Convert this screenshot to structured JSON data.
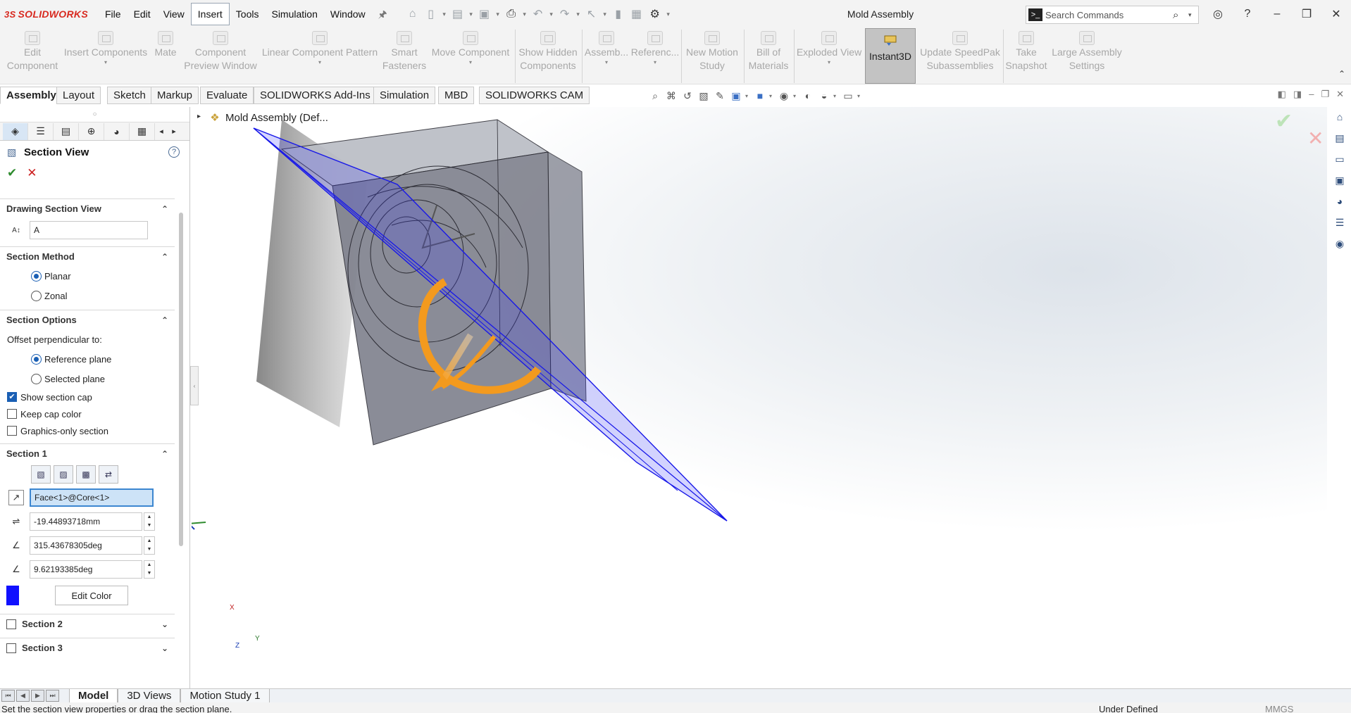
{
  "app": {
    "name": "SOLIDWORKS",
    "document_title": "Mold Assembly"
  },
  "menu": [
    "File",
    "Edit",
    "View",
    "Insert",
    "Tools",
    "Simulation",
    "Window"
  ],
  "menu_active": "Insert",
  "search": {
    "placeholder": "Search Commands"
  },
  "ribbon": {
    "edit_component": [
      "Edit",
      "Component"
    ],
    "insert_components": [
      "Insert Components"
    ],
    "mate": [
      "Mate"
    ],
    "component_preview": [
      "Component",
      "Preview Window"
    ],
    "linear_pattern": [
      "Linear Component Pattern"
    ],
    "smart_fasteners": [
      "Smart",
      "Fasteners"
    ],
    "move_component": [
      "Move Component"
    ],
    "show_hidden": [
      "Show Hidden",
      "Components"
    ],
    "assembly_features": [
      "Assemb..."
    ],
    "reference_geometry": [
      "Referenc..."
    ],
    "new_motion_study": [
      "New Motion",
      "Study"
    ],
    "bill_of_materials": [
      "Bill of",
      "Materials"
    ],
    "exploded_view": [
      "Exploded View"
    ],
    "instant3d": "Instant3D",
    "update_speedpak": [
      "Update SpeedPak",
      "Subassemblies"
    ],
    "take_snapshot": [
      "Take",
      "Snapshot"
    ],
    "large_assembly": [
      "Large Assembly",
      "Settings"
    ]
  },
  "command_tabs": [
    "Assembly",
    "Layout",
    "Sketch",
    "Markup",
    "Evaluate",
    "SOLIDWORKS Add-Ins",
    "Simulation",
    "MBD",
    "SOLIDWORKS CAM"
  ],
  "tree": {
    "root_label": "Mold Assembly (Def..."
  },
  "property_manager": {
    "title": "Section View",
    "drawing_section_view": {
      "header": "Drawing Section View",
      "name_value": "A"
    },
    "section_method": {
      "header": "Section Method",
      "options": [
        "Planar",
        "Zonal"
      ],
      "selected": "Planar"
    },
    "section_options": {
      "header": "Section Options",
      "offset_label": "Offset perpendicular to:",
      "offset_options": [
        "Reference plane",
        "Selected plane"
      ],
      "offset_selected": "Reference plane",
      "show_section_cap": {
        "label": "Show section cap",
        "checked": true
      },
      "keep_cap_color": {
        "label": "Keep cap color",
        "checked": false
      },
      "graphics_only": {
        "label": "Graphics-only section",
        "checked": false
      }
    },
    "section1": {
      "header": "Section 1",
      "reference": "Face<1>@Core<1>",
      "offset": "-19.44893718mm",
      "rot_x": "315.43678305deg",
      "rot_y": "9.62193385deg",
      "edit_color_label": "Edit Color",
      "section_color": "#1010ff"
    },
    "section2": {
      "header": "Section 2"
    },
    "section3": {
      "header": "Section 3"
    }
  },
  "triad": {
    "x": "X",
    "y": "Y",
    "z": "Z"
  },
  "bottom_tabs": [
    "Model",
    "3D Views",
    "Motion Study 1"
  ],
  "status": {
    "message": "Set the section view properties or drag the section plane.",
    "definition": "Under Defined",
    "units": "MMGS"
  }
}
